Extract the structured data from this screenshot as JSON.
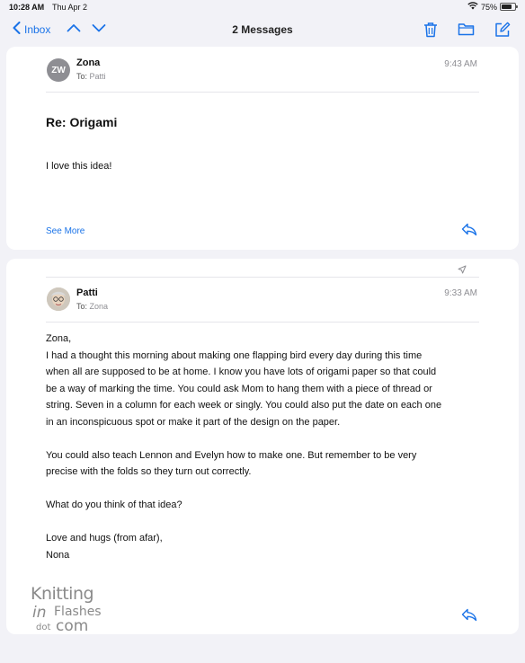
{
  "status_bar": {
    "time": "10:28 AM",
    "date": "Thu Apr 2",
    "battery": "75%",
    "wifi_icon": "wifi-icon",
    "battery_level": 0.75
  },
  "nav": {
    "back_label": "Inbox",
    "title": "2 Messages",
    "icons": [
      "chevron-left-icon",
      "chevron-up-icon",
      "chevron-down-icon",
      "trash-icon",
      "folder-icon",
      "compose-icon"
    ]
  },
  "messages": [
    {
      "avatar_initials": "ZW",
      "sender": "Zona",
      "to_label": "To:",
      "to_name": "Patti",
      "time": "9:43 AM",
      "subject": "Re:  Origami",
      "body": [
        "I love this idea!"
      ],
      "see_more": "See More"
    },
    {
      "sender": "Patti",
      "to_label": "To:",
      "to_name": "Zona",
      "time": "9:33 AM",
      "body": [
        "Zona,",
        "I had a thought this morning about making one flapping bird every day during this time",
        "when all are supposed to be at home. I know you have lots of origami paper so that could",
        "be a way of marking the time. You could ask Mom to hang them with a piece of thread or",
        "string. Seven in a column for each week or singly. You could also put the date on each one",
        "in an inconspicuous spot or make it part of the design on the paper.",
        "You could also teach Lennon and Evelyn how to make one. But remember to be very",
        "precise with the folds so they turn out correctly.",
        "What do you think of that idea?",
        "Love and hugs (from afar),",
        "Nona"
      ]
    }
  ],
  "watermark": {
    "line1": "Knitting",
    "line2a": "in",
    "line2b": "Flashes",
    "line3a": "dot",
    "line3b": "com"
  },
  "colors": {
    "accent": "#1a73e8",
    "background": "#f2f2f7",
    "card": "#ffffff",
    "secondary_text": "#8e8e93"
  }
}
